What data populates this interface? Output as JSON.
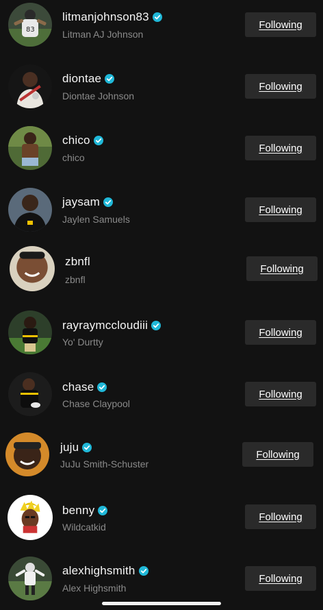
{
  "following_list": {
    "button_label": "Following",
    "accent_color": "#20b8d8",
    "items": [
      {
        "username": "litmanjohnson83",
        "display_name": "Litman AJ Johnson",
        "verified": true,
        "avatar": "football-player-avatar"
      },
      {
        "username": "diontae",
        "display_name": "Diontae Johnson",
        "verified": true,
        "avatar": "person-avatar"
      },
      {
        "username": "chico",
        "display_name": "chico",
        "verified": true,
        "avatar": "person-avatar"
      },
      {
        "username": "jaysam",
        "display_name": "Jaylen Samuels",
        "verified": true,
        "avatar": "football-player-avatar"
      },
      {
        "username": "zbnfl",
        "display_name": "zbnfl",
        "verified": false,
        "avatar": "person-avatar"
      },
      {
        "username": "rayraymccloudiii",
        "display_name": "Yo' Durtty",
        "verified": true,
        "avatar": "football-player-avatar"
      },
      {
        "username": "chase",
        "display_name": "Chase Claypool",
        "verified": true,
        "avatar": "football-player-avatar"
      },
      {
        "username": "juju",
        "display_name": "JuJu Smith-Schuster",
        "verified": true,
        "avatar": "person-avatar"
      },
      {
        "username": "benny",
        "display_name": "Wildcatkid",
        "verified": true,
        "avatar": "cartoon-avatar"
      },
      {
        "username": "alexhighsmith",
        "display_name": "Alex Highsmith",
        "verified": true,
        "avatar": "football-player-avatar"
      }
    ]
  }
}
